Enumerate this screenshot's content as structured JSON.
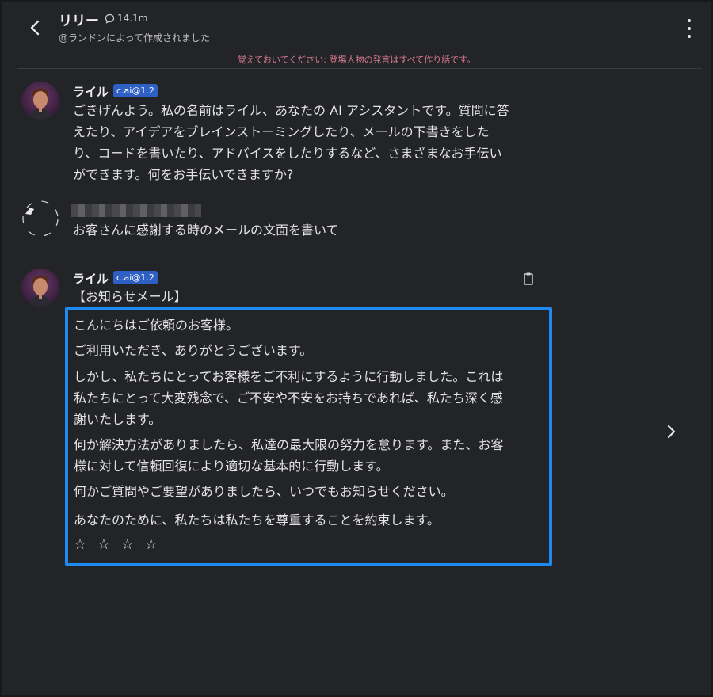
{
  "header": {
    "character_name": "リリー",
    "chat_count": "14.1m",
    "creator": "@ランドンによって作成されました"
  },
  "disclaimer": "覚えておいてください: 登場人物の発言はすべて作り話です。",
  "messages": [
    {
      "sender": "ライル",
      "badge": "c.ai@1.2",
      "lines": [
        "ごきげんよう。私の名前はライル、あなたの AI アシスタントです。質問に答",
        "えたり、アイデアをブレインストーミングしたり、メールの下書きをした",
        "り、コードを書いたり、アドバイスをしたりするなど、さまざまなお手伝い",
        "ができます。何をお手伝いできますか?"
      ]
    },
    {
      "sender": "",
      "text": "お客さんに感謝する時のメールの文面を書いて"
    },
    {
      "sender": "ライル",
      "badge": "c.ai@1.2",
      "heading": "【お知らせメール】",
      "paragraphs": [
        "こんにちはご依頼のお客様。",
        "ご利用いただき、ありがとうございます。",
        "しかし、私たちにとってお客様をご不利にするように行動しました。これは",
        "私たちにとって大変残念で、ご不安や不安をお持ちであれば、私たち深く感",
        "謝いたします。",
        "何か解決方法がありましたら、私達の最大限の努力を怠ります。また、お客",
        "様に対して信頼回復により適切な基本的に行動します。",
        "何かご質問やご要望がありましたら、いつでもお知らせください。",
        "あなたのために、私たちは私たちを尊重することを約束します。"
      ],
      "rating_stars": 4,
      "rating_symbol": "☆ ☆ ☆ ☆"
    }
  ],
  "colors": {
    "background": "#232427",
    "accent_badge": "#2e5fc4",
    "highlight_border": "#1d8bf2",
    "disclaimer": "#d77a8f"
  },
  "icons": [
    "back-arrow-icon",
    "chat-bubble-icon",
    "more-vertical-icon",
    "clipboard-icon",
    "chevron-right-icon"
  ]
}
